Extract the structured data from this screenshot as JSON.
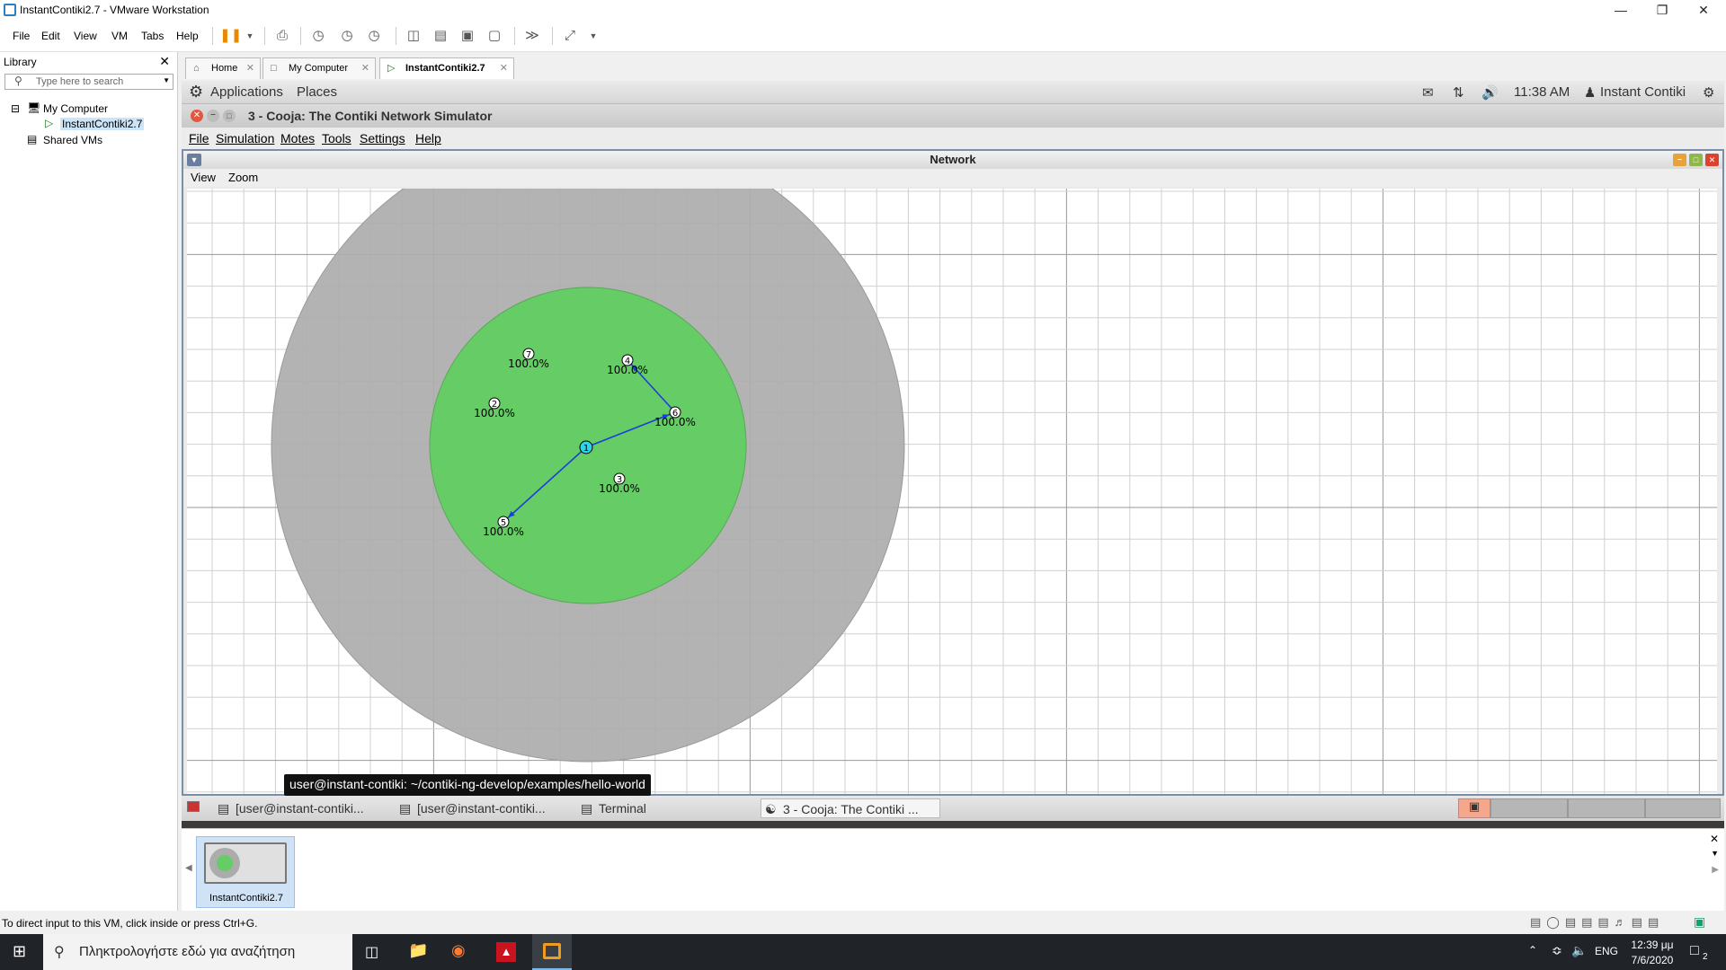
{
  "window": {
    "title": "InstantContiki2.7 - VMware Workstation"
  },
  "menubar": {
    "items": [
      "File",
      "Edit",
      "View",
      "VM",
      "Tabs",
      "Help"
    ]
  },
  "library": {
    "title": "Library",
    "search_placeholder": "Type here to search",
    "tree": {
      "root": "My Computer",
      "child": "InstantContiki2.7",
      "shared": "Shared VMs"
    }
  },
  "tabs": [
    {
      "label": "Home"
    },
    {
      "label": "My Computer"
    },
    {
      "label": "InstantContiki2.7"
    }
  ],
  "gnome_panel": {
    "applications": "Applications",
    "places": "Places",
    "time": "11:38 AM",
    "user": "Instant Contiki"
  },
  "cooja": {
    "title": "3 - Cooja: The Contiki Network Simulator",
    "menu": [
      "File",
      "Simulation",
      "Motes",
      "Tools",
      "Settings",
      "Help"
    ],
    "network": {
      "title": "Network",
      "menu": [
        "View",
        "Zoom"
      ],
      "motes": [
        {
          "id": "1",
          "selected": true
        },
        {
          "id": "2",
          "label": "100.0%"
        },
        {
          "id": "3",
          "label": "100.0%"
        },
        {
          "id": "4",
          "label": "100.0%"
        },
        {
          "id": "5",
          "label": "100.0%"
        },
        {
          "id": "6",
          "label": "100.0%"
        },
        {
          "id": "7",
          "label": "100.0%"
        }
      ],
      "colors": {
        "interference_range": "#acacac",
        "tx_range": "#66cc66",
        "link": "#1a3fd9",
        "selected_mote": "#2fd4e8"
      }
    }
  },
  "tooltip": "user@instant-contiki: ~/contiki-ng-develop/examples/hello-world",
  "vm_taskbar": {
    "items": [
      "[user@instant-contiki...",
      "[user@instant-contiki...",
      "Terminal",
      "3 - Cooja: The Contiki ..."
    ]
  },
  "thumbnail": {
    "label": "InstantContiki2.7"
  },
  "statusbar": {
    "text": "To direct input to this VM, click inside or press Ctrl+G."
  },
  "win_taskbar": {
    "search_placeholder": "Πληκτρολογήστε εδώ για αναζήτηση",
    "lang": "ENG",
    "time": "12:39 μμ",
    "date": "7/6/2020",
    "notif_count": "2"
  }
}
